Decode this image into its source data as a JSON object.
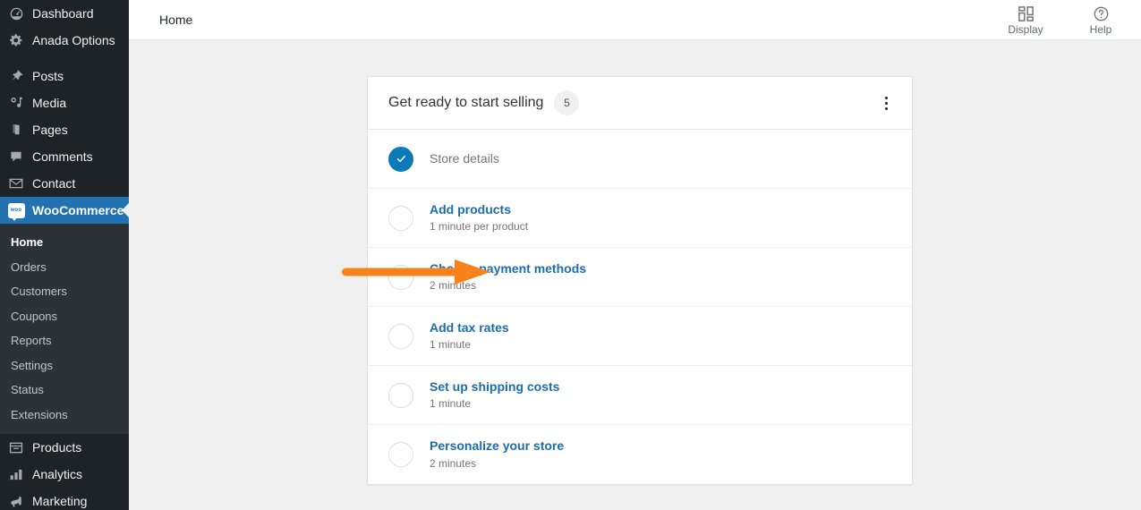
{
  "sidebar": {
    "items": [
      {
        "label": "Dashboard",
        "icon": "dashboard-icon",
        "current": false
      },
      {
        "label": "Anada Options",
        "icon": "gear-icon",
        "current": false
      },
      {
        "label": "Posts",
        "icon": "pin-icon",
        "current": false
      },
      {
        "label": "Media",
        "icon": "media-icon",
        "current": false
      },
      {
        "label": "Pages",
        "icon": "pages-icon",
        "current": false
      },
      {
        "label": "Comments",
        "icon": "comment-icon",
        "current": false
      },
      {
        "label": "Contact",
        "icon": "envelope-icon",
        "current": false
      },
      {
        "label": "WooCommerce",
        "icon": "woocommerce-icon",
        "current": true
      },
      {
        "label": "Products",
        "icon": "products-icon",
        "current": false
      },
      {
        "label": "Analytics",
        "icon": "analytics-icon",
        "current": false
      },
      {
        "label": "Marketing",
        "icon": "megaphone-icon",
        "current": false
      }
    ],
    "woo_icon_text": "woo",
    "submenu": [
      {
        "label": "Home",
        "active": true
      },
      {
        "label": "Orders",
        "active": false
      },
      {
        "label": "Customers",
        "active": false
      },
      {
        "label": "Coupons",
        "active": false
      },
      {
        "label": "Reports",
        "active": false
      },
      {
        "label": "Settings",
        "active": false
      },
      {
        "label": "Status",
        "active": false
      },
      {
        "label": "Extensions",
        "active": false
      }
    ]
  },
  "topbar": {
    "breadcrumb": "Home",
    "display_label": "Display",
    "help_label": "Help"
  },
  "card": {
    "title": "Get ready to start selling",
    "count": "5",
    "menu_icon": "ellipsis-vertical-icon",
    "tasks": [
      {
        "title": "Store details",
        "time": "",
        "done": true
      },
      {
        "title": "Add products",
        "time": "1 minute per product",
        "done": false
      },
      {
        "title": "Choose payment methods",
        "time": "2 minutes",
        "done": false
      },
      {
        "title": "Add tax rates",
        "time": "1 minute",
        "done": false
      },
      {
        "title": "Set up shipping costs",
        "time": "1 minute",
        "done": false
      },
      {
        "title": "Personalize your store",
        "time": "2 minutes",
        "done": false
      }
    ]
  },
  "annotation": {
    "arrow_color": "#f7821b",
    "points_to": "Choose payment methods"
  },
  "colors": {
    "sidebar_bg": "#1d2327",
    "submenu_bg": "#2c3338",
    "accent_blue": "#2271b1",
    "link_blue": "#1a6dae",
    "done_blue": "#0c7ab8",
    "page_bg": "#f0f0f1"
  }
}
